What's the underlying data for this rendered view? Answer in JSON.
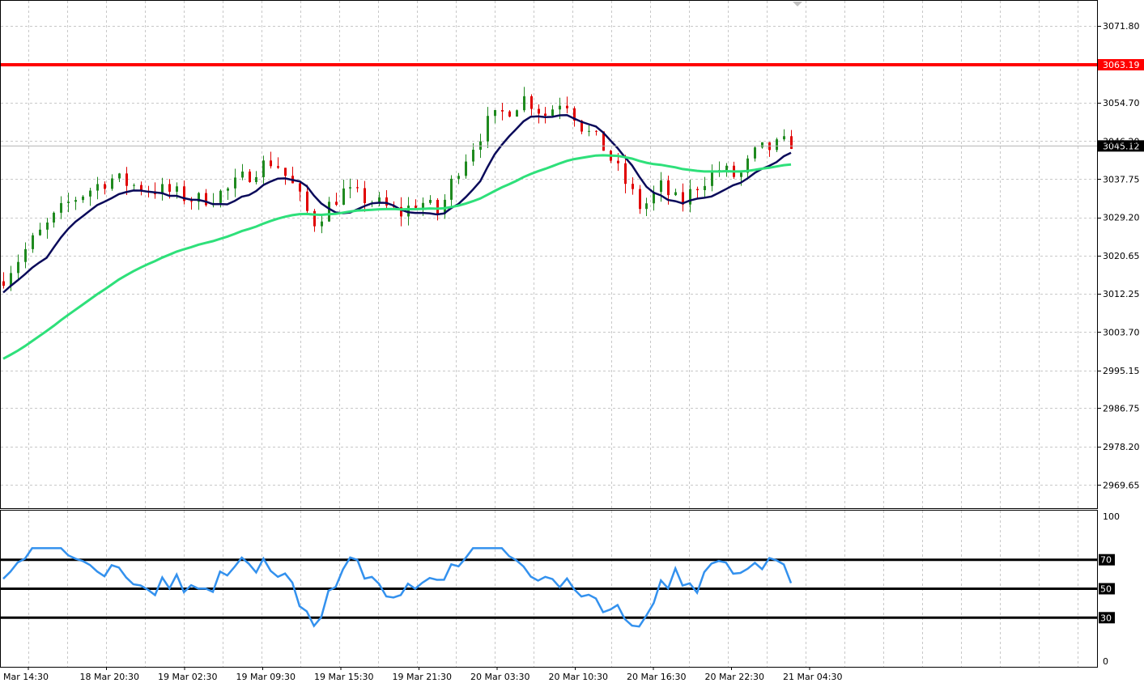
{
  "chart_data": [
    {
      "type": "candlestick",
      "price_axis": {
        "ticks": [
          "3071.80",
          "3054.70",
          "3046.20",
          "3037.75",
          "3029.20",
          "3020.65",
          "3012.25",
          "3003.70",
          "2995.15",
          "2986.75",
          "2978.20",
          "2969.65"
        ],
        "range": [
          2964.5,
          3077.6
        ]
      },
      "horizontal_levels": [
        {
          "value": 3063.19,
          "label": "3063.19",
          "color": "#ff0000"
        }
      ],
      "current_price": {
        "value": 3045.12,
        "label": "3045.12",
        "color": "#000000"
      },
      "series": [
        {
          "kind": "moving_average",
          "color": "#0a0a5a"
        },
        {
          "kind": "moving_average",
          "color": "#2ee07a"
        }
      ],
      "colors": {
        "bull": "#1f8a1f",
        "bear": "#e00000"
      },
      "candle_count": 110
    },
    {
      "type": "line",
      "y_ticks": [
        "100",
        "0"
      ],
      "ylim": [
        0,
        100
      ],
      "levels": [
        {
          "value": 70,
          "label": "70"
        },
        {
          "value": 50,
          "label": "50"
        },
        {
          "value": 30,
          "label": "30"
        }
      ],
      "line_color": "#3391ee"
    }
  ],
  "x_axis": {
    "labels": [
      "Mar 14:30",
      "18 Mar 20:30",
      "19 Mar 02:30",
      "19 Mar 09:30",
      "19 Mar 15:30",
      "19 Mar 21:30",
      "20 Mar 03:30",
      "20 Mar 10:30",
      "20 Mar 16:30",
      "20 Mar 22:30",
      "21 Mar 04:30"
    ]
  }
}
